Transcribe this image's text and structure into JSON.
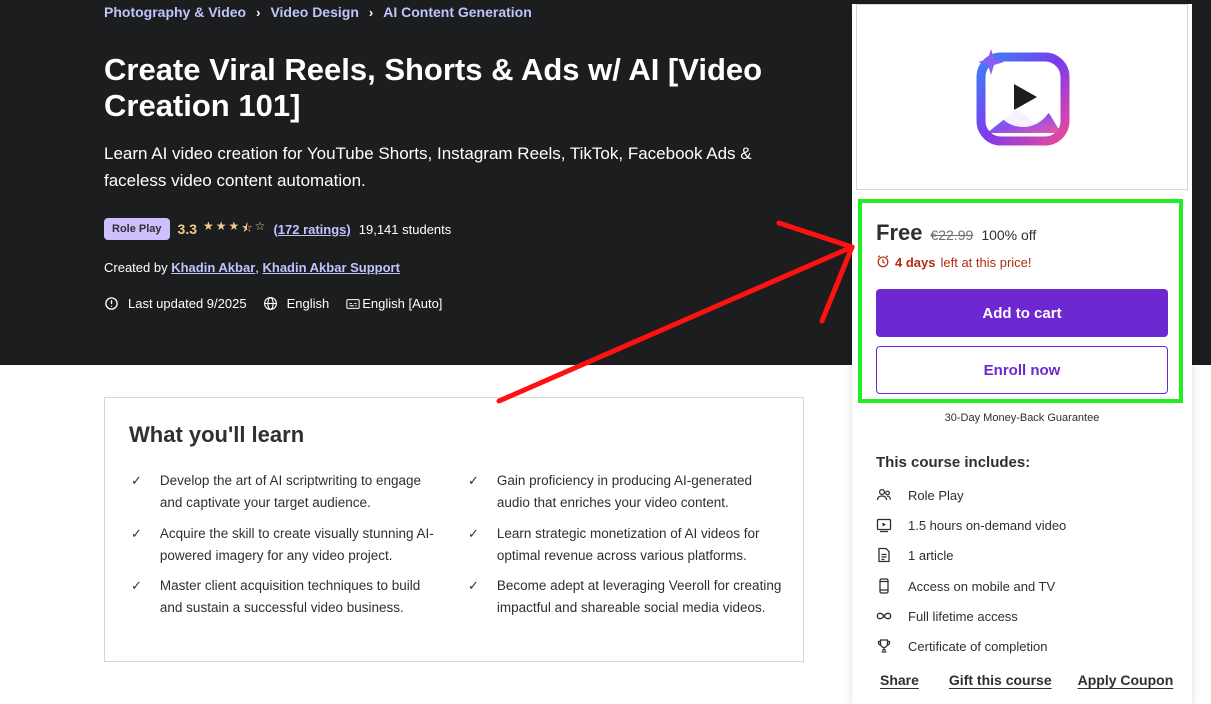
{
  "breadcrumb": [
    {
      "label": "Photography & Video"
    },
    {
      "label": "Video Design"
    },
    {
      "label": "AI Content Generation"
    }
  ],
  "course": {
    "title": "Create Viral Reels, Shorts & Ads w/ AI [Video Creation 101]",
    "subtitle": "Learn AI video creation for YouTube Shorts, Instagram Reels, TikTok, Facebook Ads & faceless video content automation.",
    "badge": "Role Play",
    "rating": "3.3",
    "rating_stars": 3.5,
    "ratings_count": "(172 ratings)",
    "students": "19,141 students",
    "created_by_label": "Created by",
    "authors": [
      "Khadin Akbar",
      "Khadin Akbar Support"
    ],
    "last_updated": "Last updated 9/2025",
    "language": "English",
    "captions": "English [Auto]"
  },
  "learn": {
    "title": "What you'll learn",
    "items": [
      "Develop the art of AI scriptwriting to engage and captivate your target audience.",
      "Gain proficiency in producing AI-generated audio that enriches your video content.",
      "Acquire the skill to create visually stunning AI-powered imagery for any video project.",
      "Learn strategic monetization of AI videos for optimal revenue across various platforms.",
      "Master client acquisition techniques to build and sustain a successful video business.",
      "Become adept at leveraging Veeroll for creating impactful and shareable social media videos."
    ]
  },
  "purchase": {
    "price": "Free",
    "original_price": "€22.99",
    "discount": "100% off",
    "timer_days": "4 days",
    "timer_rest": "left at this price!",
    "add_to_cart": "Add to cart",
    "enroll_now": "Enroll now",
    "guarantee": "30-Day Money-Back Guarantee"
  },
  "includes": {
    "title": "This course includes:",
    "items": [
      {
        "icon": "people-icon",
        "label": "Role Play"
      },
      {
        "icon": "video-icon",
        "label": "1.5 hours on-demand video"
      },
      {
        "icon": "article-icon",
        "label": "1 article"
      },
      {
        "icon": "mobile-icon",
        "label": "Access on mobile and TV"
      },
      {
        "icon": "infinity-icon",
        "label": "Full lifetime access"
      },
      {
        "icon": "trophy-icon",
        "label": "Certificate of completion"
      }
    ]
  },
  "footer_links": {
    "share": "Share",
    "gift": "Gift this course",
    "coupon": "Apply Coupon"
  },
  "colors": {
    "hero_bg": "#1c1d1f",
    "accent": "#6d28d2",
    "link": "#c0c4fc",
    "star": "#f3ca8c",
    "highlight": "#22ee22",
    "annotation_arrow": "#ff1111"
  }
}
